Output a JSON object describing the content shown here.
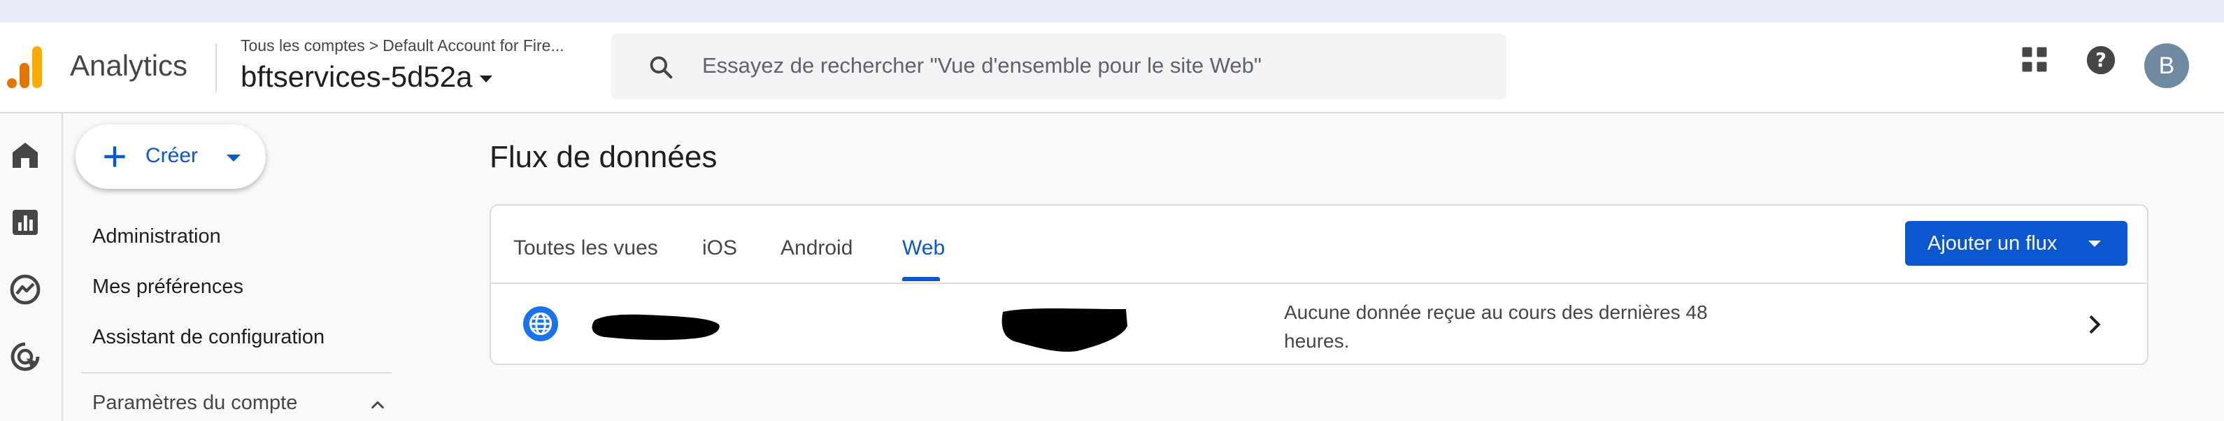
{
  "header": {
    "app_name": "Analytics",
    "breadcrumb": {
      "root": "Tous les comptes",
      "separator": ">",
      "account": "Default Account for Fire..."
    },
    "property": "bftservices-5d52a",
    "search_placeholder": "Essayez de rechercher \"Vue d'ensemble pour le site Web\"",
    "avatar_initial": "B"
  },
  "sidebar": {
    "create_label": "Créer",
    "items": [
      {
        "label": "Administration"
      },
      {
        "label": "Mes préférences"
      },
      {
        "label": "Assistant de configuration"
      }
    ],
    "section": {
      "label": "Paramètres du compte",
      "expanded": true
    }
  },
  "main": {
    "title": "Flux de données",
    "tabs": [
      {
        "label": "Toutes les vues",
        "active": false
      },
      {
        "label": "iOS",
        "active": false
      },
      {
        "label": "Android",
        "active": false
      },
      {
        "label": "Web",
        "active": true
      }
    ],
    "add_button": "Ajouter un flux",
    "streams": [
      {
        "status": "Aucune donnée reçue au cours des dernières 48 heures."
      }
    ]
  },
  "colors": {
    "accent": "#0b57d0",
    "logo_orange": "#e37400",
    "logo_yellow": "#f9ab00",
    "avatar": "#6f8aa0"
  }
}
